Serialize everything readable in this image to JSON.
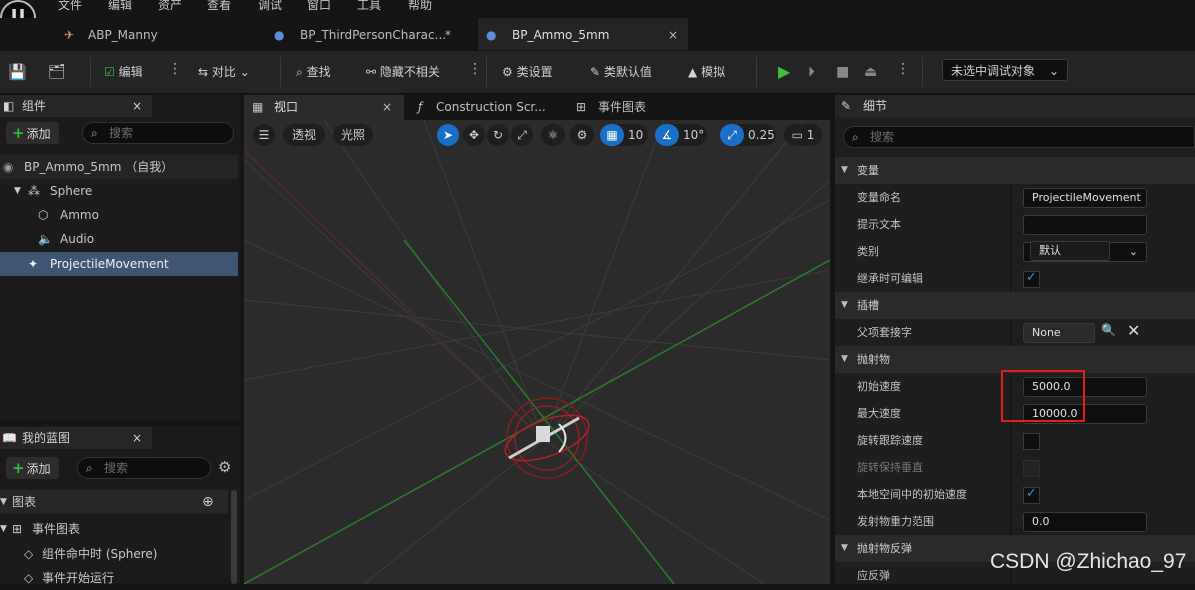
{
  "menu": [
    "文件",
    "编辑",
    "资产",
    "查看",
    "调试",
    "窗口",
    "工具",
    "帮助"
  ],
  "tabs": [
    {
      "label": "ABP_Manny",
      "icon": "anim-blueprint-icon"
    },
    {
      "label": "BP_ThirdPersonCharac...",
      "icon": "character-icon",
      "modified": "*"
    },
    {
      "label": "BP_Ammo_5mm",
      "icon": "blueprint-icon",
      "close": "×"
    }
  ],
  "toolbar": {
    "compile": "编辑",
    "diff": "对比",
    "find": "查找",
    "hide_unrelated": "隐藏不相关",
    "class_settings": "类设置",
    "class_defaults": "类默认值",
    "simulate": "模拟",
    "debug_object": "未选中调试对象"
  },
  "components": {
    "title": "组件",
    "add": "添加",
    "search_placeholder": "搜索",
    "tree": [
      "BP_Ammo_5mm （自我）",
      "Sphere",
      "Ammo",
      "Audio",
      "ProjectileMovement"
    ]
  },
  "my_blueprint": {
    "title": "我的蓝图",
    "add": "添加",
    "search_placeholder": "搜索",
    "section": "图表",
    "event_graph": "事件图表",
    "events": [
      "组件命中时 (Sphere)",
      "事件开始运行"
    ]
  },
  "editor_tabs": {
    "viewport": "视口",
    "construction": "Construction Scr...",
    "event_graph": "事件图表"
  },
  "viewport": {
    "perspective": "透视",
    "lit": "光照",
    "grid_snap": "10",
    "rotation_snap": "10°",
    "scale_snap": "0.25",
    "camera_speed": "1"
  },
  "details": {
    "title": "细节",
    "search_placeholder": "搜索",
    "sections": {
      "variable": "变量",
      "sockets": "插槽",
      "projectile": "抛射物",
      "bounce": "抛射物反弹"
    },
    "variable_name_label": "变量命名",
    "variable_name": "ProjectileMovement",
    "tooltip_label": "提示文本",
    "tooltip_value": "",
    "category_label": "类别",
    "category_value": "默认",
    "editable_label": "继承时可编辑",
    "parent_socket_label": "父项套接字",
    "parent_socket_value": "None",
    "initial_speed_label": "初始速度",
    "initial_speed": "5000.0",
    "max_speed_label": "最大速度",
    "max_speed": "10000.0",
    "rotation_follows_velocity_label": "旋转跟踪速度",
    "rotation_remains_vertical_label": "旋转保持垂直",
    "initial_velocity_local_label": "本地空间中的初始速度",
    "gravity_scale_label": "发射物重力范围",
    "gravity_scale": "0.0",
    "should_bounce_label": "应反弹"
  },
  "watermark": "CSDN @Zhichao_97",
  "colors": {
    "accent": "#1c6fc6",
    "play": "#3fbf3f",
    "highlight_box": "#e02020",
    "grid_green": "#2d7a2d"
  }
}
